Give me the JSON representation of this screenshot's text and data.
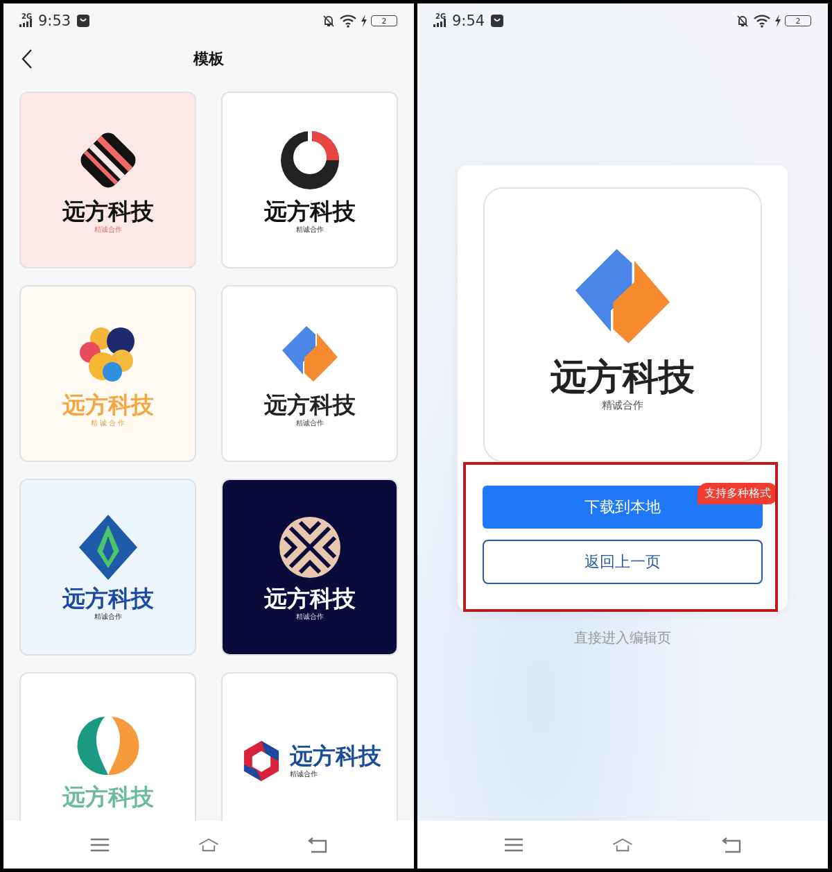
{
  "left_screen": {
    "status_bar": {
      "network": "2G",
      "time": "9:53",
      "battery": "2"
    },
    "header": {
      "title": "模板"
    },
    "templates": [
      {
        "kind": "stripes",
        "color": "#fde8e8",
        "title": "远方科技",
        "subtitle": "精诚合作"
      },
      {
        "kind": "ring",
        "color": "#ffffff",
        "title": "远方科技",
        "subtitle": "精诚合作"
      },
      {
        "kind": "blobs",
        "color": "#fffbf2",
        "title": "远方科技",
        "subtitle": "精 诚 合 作"
      },
      {
        "kind": "arrows",
        "color": "#ffffff",
        "title": "远方科技",
        "subtitle": "精诚合作"
      },
      {
        "kind": "diamond",
        "color": "#edf5fd",
        "title": "远方科技",
        "subtitle": "精诚合作"
      },
      {
        "kind": "cross",
        "color": "#0b0b3b",
        "title": "远方科技",
        "subtitle": "精诚合作"
      },
      {
        "kind": "drop",
        "color": "#ffffff",
        "title": "远方科技"
      },
      {
        "kind": "hex",
        "color": "#ffffff",
        "title": "远方科技",
        "subtitle": "精诚合作"
      }
    ]
  },
  "right_screen": {
    "status_bar": {
      "network": "2G",
      "time": "9:54",
      "battery": "2"
    },
    "preview": {
      "kind": "arrows",
      "title": "远方科技",
      "subtitle": "精诚合作"
    },
    "actions": {
      "highlight": true,
      "download": "下载到本地",
      "badge": "支持多种格式",
      "back": "返回上一页"
    },
    "edit_link": "直接进入编辑页"
  }
}
